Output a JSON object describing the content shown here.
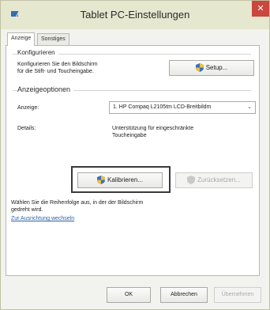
{
  "window": {
    "title": "Tablet PC-Einstellungen",
    "close_symbol": "✕"
  },
  "tabs": [
    {
      "label": "Anzeige"
    },
    {
      "label": "Sonstiges"
    }
  ],
  "configure": {
    "title": "Konfigurieren",
    "description_line1": "Konfigurieren Sie den Bildschirm",
    "description_line2": "für die Stift- und Toucheingabe.",
    "setup_label": "Setup..."
  },
  "display_options": {
    "title": "Anzeigeoptionen",
    "display_label": "Anzeige:",
    "display_value": "1. HP Compaq L2105tm LCD-Breitbildm",
    "details_label": "Details:",
    "details_line1": "Unterstützung für eingeschränkte",
    "details_line2": "Toucheingabe",
    "calibrate_label": "Kalibrieren...",
    "reset_label": "Zurücksetzen..."
  },
  "orientation": {
    "text_line1": "Wählen Sie die Reihenfolge aus, in der der Bildschirm",
    "text_line2": "gedreht wird.",
    "link_label": "Zur Ausrichtung wechseln"
  },
  "footer": {
    "ok_label": "OK",
    "cancel_label": "Abbrechen",
    "apply_label": "Übernehmen"
  },
  "colors": {
    "titlebar": "#e6e7cf",
    "close": "#c9473c",
    "link": "#2a5fa8",
    "shield_blue": "#3b6fc4",
    "shield_yellow": "#e8c23a"
  }
}
